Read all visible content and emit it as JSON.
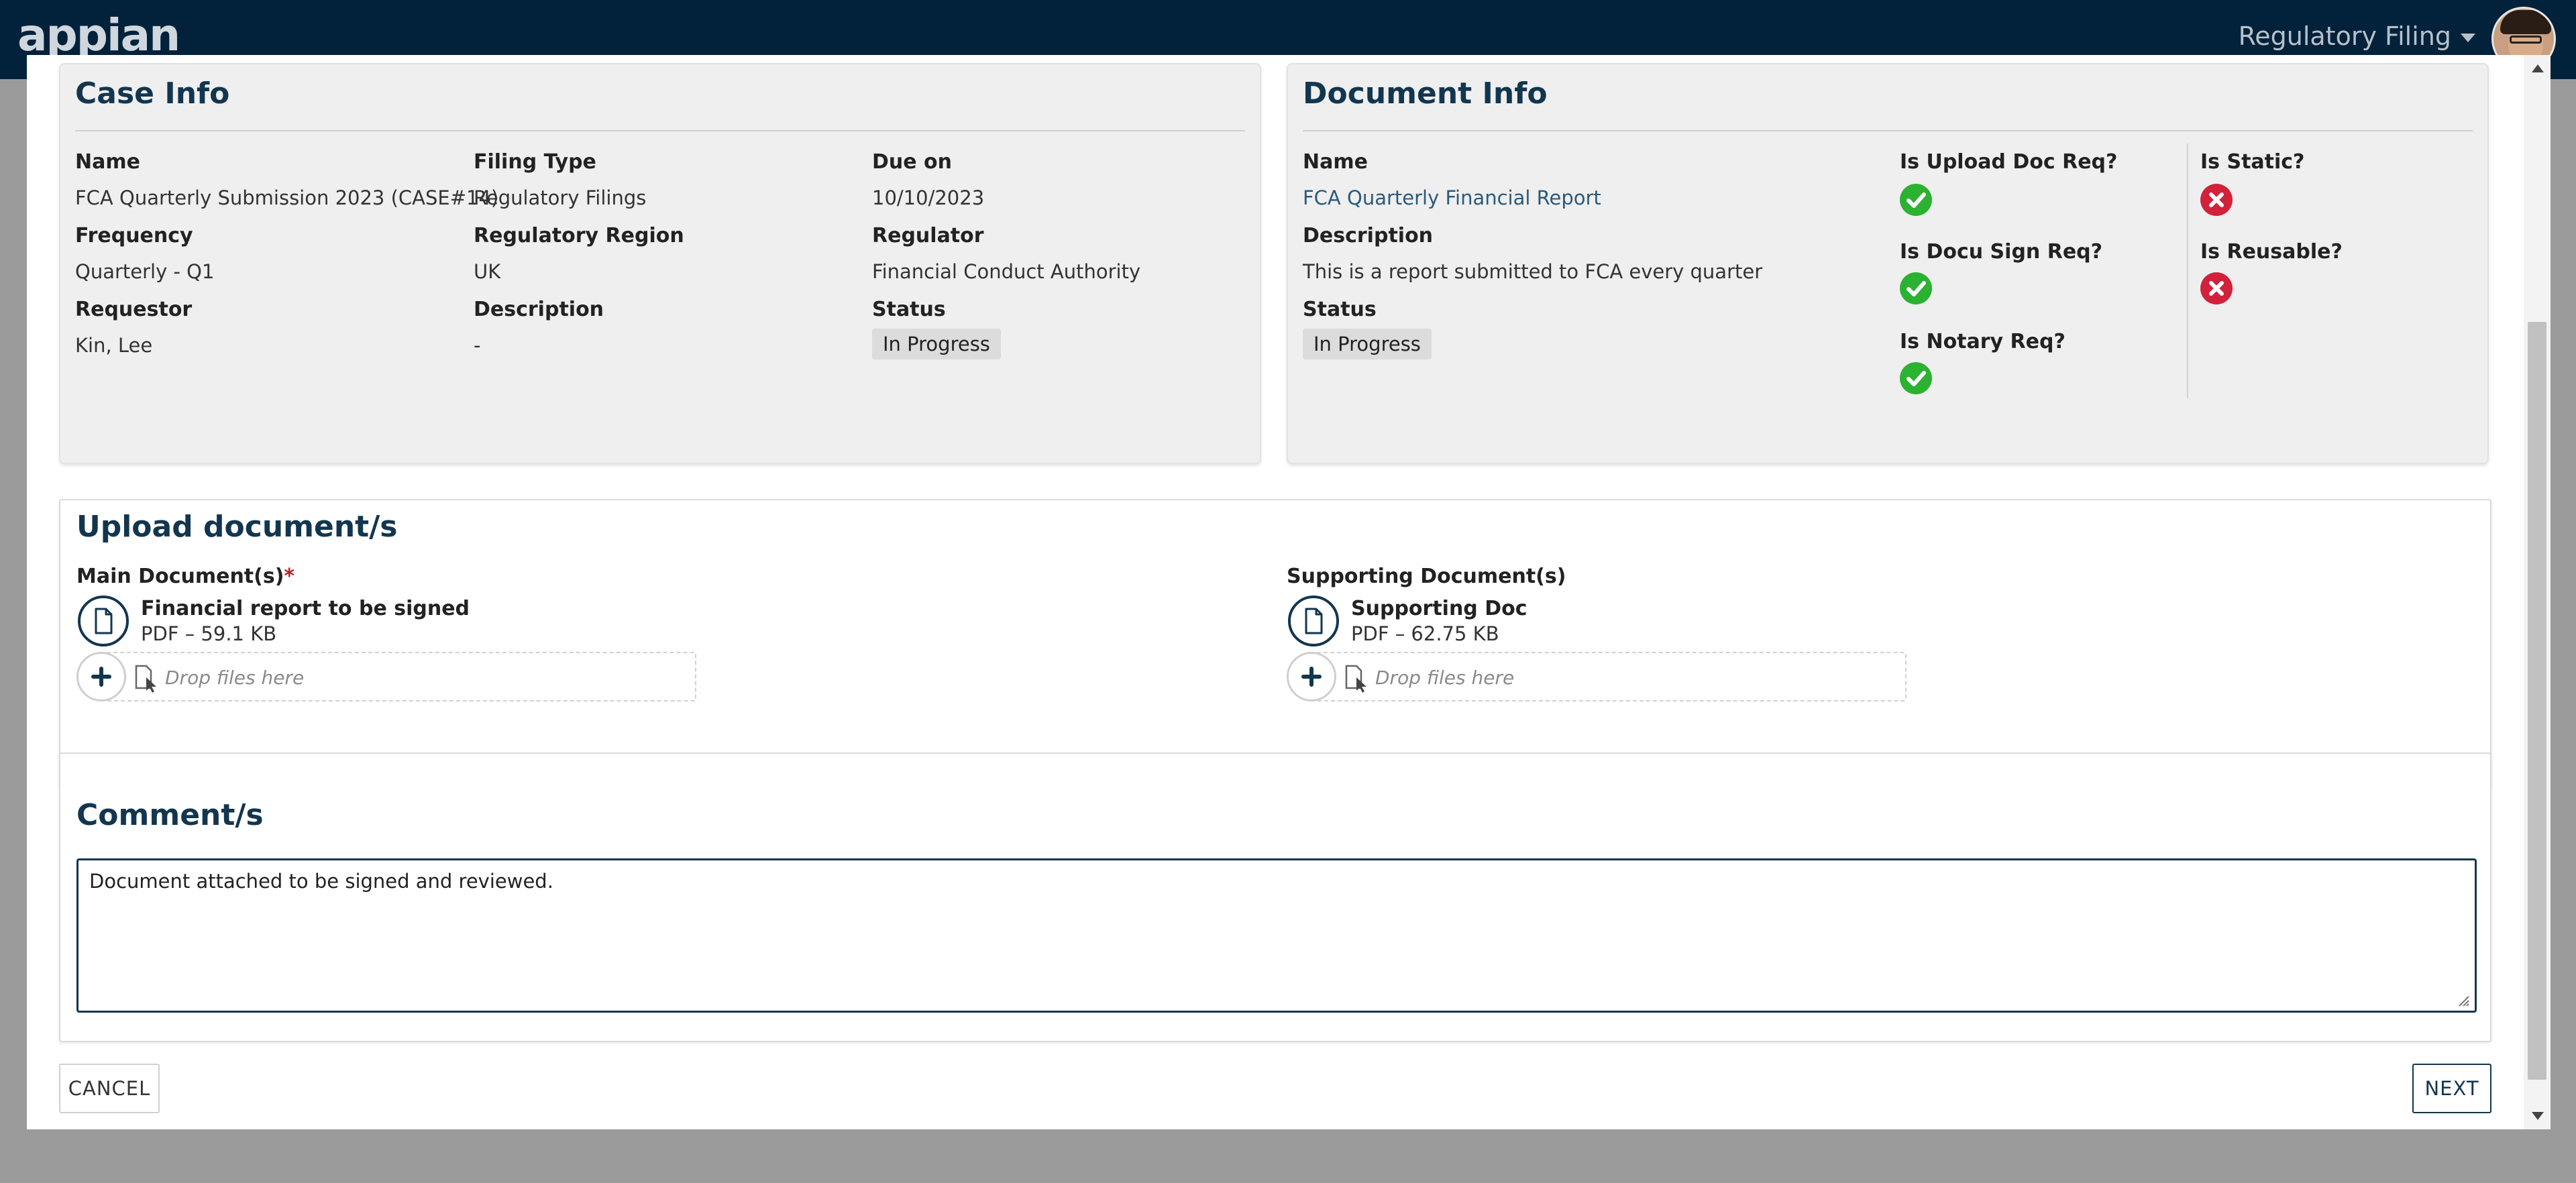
{
  "header": {
    "logo": "appian",
    "app_switcher": "Regulatory Filing"
  },
  "case_info": {
    "title": "Case Info",
    "fields": {
      "name_label": "Name",
      "name_value": "FCA Quarterly Submission 2023 (CASE#14)",
      "filing_type_label": "Filing Type",
      "filing_type_value": "Regulatory Filings",
      "due_on_label": "Due on",
      "due_on_value": "10/10/2023",
      "frequency_label": "Frequency",
      "frequency_value": "Quarterly - Q1",
      "region_label": "Regulatory Region",
      "region_value": "UK",
      "regulator_label": "Regulator",
      "regulator_value": "Financial Conduct Authority",
      "requestor_label": "Requestor",
      "requestor_value": "Kin, Lee",
      "description_label": "Description",
      "description_value": "-",
      "status_label": "Status",
      "status_value": "In Progress"
    }
  },
  "document_info": {
    "title": "Document Info",
    "name_label": "Name",
    "name_value": "FCA Quarterly Financial Report",
    "description_label": "Description",
    "description_value": "This is a report submitted to FCA every quarter",
    "status_label": "Status",
    "status_value": "In Progress",
    "upload_req_label": "Is Upload Doc Req?",
    "docu_sign_label": "Is Docu Sign Req?",
    "notary_label": "Is Notary Req?",
    "static_label": "Is Static?",
    "reusable_label": "Is Reusable?",
    "ok_icon": "check-circle-icon",
    "no_icon": "x-circle-icon",
    "ok_color": "#2bb231",
    "no_color": "#d1213b"
  },
  "upload": {
    "title": "Upload document/s",
    "main_label": "Main Document(s)",
    "required_mark": "*",
    "main_file_name": "Financial report to be signed",
    "main_file_meta": "PDF – 59.1 KB",
    "supporting_label": "Supporting Document(s)",
    "supporting_file_name": "Supporting Doc",
    "supporting_file_meta": "PDF – 62.75 KB",
    "drop_text": "Drop files here"
  },
  "comments": {
    "title": "Comment/s",
    "value": "Document attached to be signed and reviewed."
  },
  "actions": {
    "cancel": "CANCEL",
    "next": "NEXT"
  },
  "colors": {
    "header_bg": "#02213a",
    "title_color": "#13364f",
    "link_color": "#2a5a7c"
  }
}
